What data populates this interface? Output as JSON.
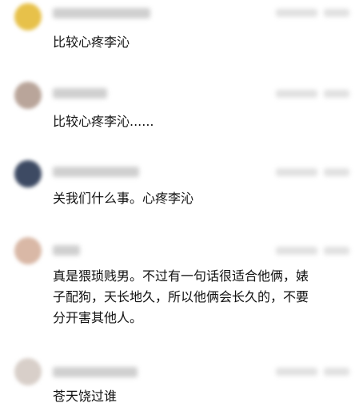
{
  "comments": [
    {
      "text": "比较心疼李沁"
    },
    {
      "text": "比较心疼李沁......"
    },
    {
      "text": "关我们什么事。心疼李沁"
    },
    {
      "text": "真是猥琐贱男。不过有一句话很适合他俩，婊\n子配狗，天长地久，所以他俩会长久的，不要\n分开害其他人。"
    },
    {
      "text": "苍天饶过谁"
    }
  ]
}
